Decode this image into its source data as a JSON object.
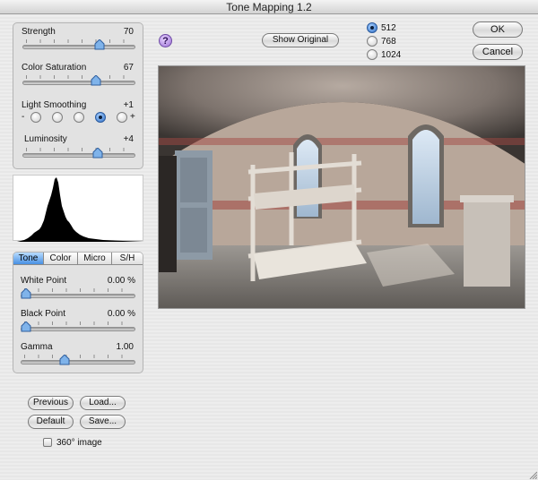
{
  "window": {
    "title": "Tone Mapping 1.2"
  },
  "sliders_top": [
    {
      "label": "Strength",
      "value": "70",
      "fraction": 0.7
    },
    {
      "label": "Color Saturation",
      "value": "67",
      "fraction": 0.67
    }
  ],
  "light_smoothing": {
    "label": "Light Smoothing",
    "value": "+1",
    "minus": "-",
    "plus": "+",
    "options": 5,
    "selected_index": 3
  },
  "luminosity": {
    "label": "Luminosity",
    "value": "+4",
    "fraction": 0.68
  },
  "tabs": [
    {
      "label": "Tone",
      "active": true
    },
    {
      "label": "Color",
      "active": false
    },
    {
      "label": "Micro",
      "active": false
    },
    {
      "label": "S/H",
      "active": false
    }
  ],
  "tone_sliders": [
    {
      "label": "White Point",
      "value": "0.00 %",
      "fraction": 0.0
    },
    {
      "label": "Black Point",
      "value": "0.00  %",
      "fraction": 0.0
    },
    {
      "label": "Gamma",
      "value": "1.00",
      "fraction": 0.37
    }
  ],
  "buttons": {
    "show_original": "Show Original",
    "ok": "OK",
    "cancel": "Cancel",
    "previous": "Previous",
    "load": "Load...",
    "default": "Default",
    "save": "Save..."
  },
  "preview_size": {
    "options": [
      "512",
      "768",
      "1024"
    ],
    "selected": "512"
  },
  "checkbox_360": {
    "label": "360° image",
    "checked": false
  },
  "icons": {
    "help": "?",
    "thumb": "slider-thumb-icon",
    "resize": "resize-grip-icon"
  },
  "colors": {
    "accent": "#3f8ae0",
    "help_purple": "#9b6fd6",
    "histogram": "#000000"
  }
}
